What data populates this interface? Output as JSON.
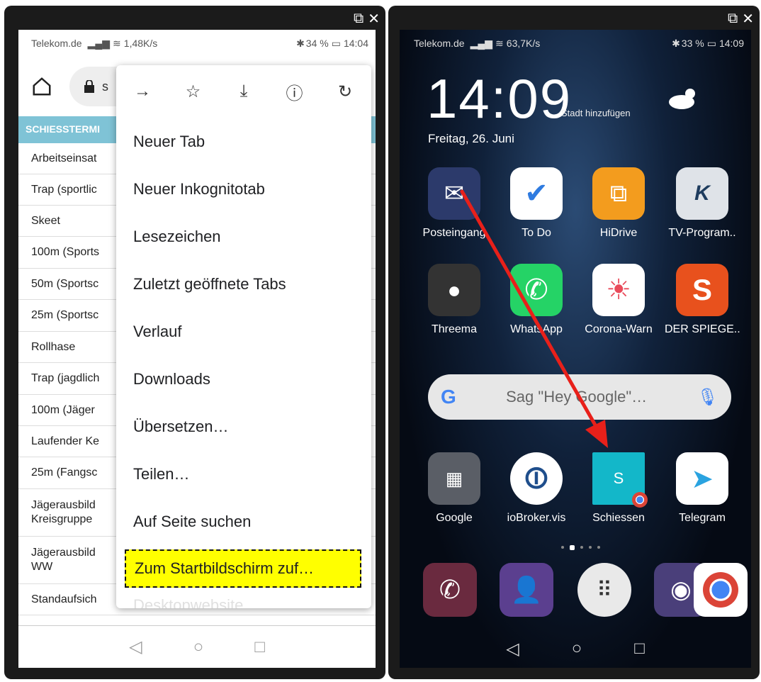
{
  "left": {
    "status": {
      "carrier": "Telekom.de",
      "speed": "1,48K/s",
      "battery": "34 %",
      "time": "14:04"
    },
    "url_prefix": "s",
    "list_header": "SCHIESSTERMI",
    "list_items": [
      "Arbeitseinsat",
      "Trap (sportlic",
      "Skeet",
      "100m (Sports",
      "50m (Sportsc",
      "25m (Sportsc",
      "Rollhase",
      "Trap (jagdlich",
      "100m (Jäger",
      "Laufender Ke",
      "25m (Fangsc",
      "Jägerausbild\nKreisgruppe",
      "Jägerausbild\nWW",
      "Standaufsich"
    ],
    "menu_icons": [
      "forward-icon",
      "star-icon",
      "download-icon",
      "info-icon",
      "refresh-icon"
    ],
    "menu": {
      "new_tab": "Neuer Tab",
      "incognito": "Neuer Inkognitotab",
      "bookmarks": "Lesezeichen",
      "recent_tabs": "Zuletzt geöffnete Tabs",
      "history": "Verlauf",
      "downloads": "Downloads",
      "translate": "Übersetzen…",
      "share": "Teilen…",
      "find": "Auf Seite suchen",
      "add_home": "Zum Startbildschirm zuf…",
      "desktop": "Desktopwebsite"
    }
  },
  "right": {
    "status": {
      "carrier": "Telekom.de",
      "speed": "63,7K/s",
      "battery": "33 %",
      "time": "14:09"
    },
    "clock": "14:09",
    "city": "Stadt hinzufügen",
    "date": "Freitag, 26. Juni",
    "apps_row1": [
      "Posteingang",
      "To Do",
      "HiDrive",
      "TV-Program.."
    ],
    "apps_row2": [
      "Threema",
      "WhatsApp",
      "Corona-Warn",
      "DER SPIEGE.."
    ],
    "search_placeholder": "Sag \"Hey Google\"…",
    "apps_row3": [
      "Google",
      "ioBroker.vis",
      "Schiessen",
      "Telegram"
    ],
    "schiessen_letter": "S",
    "colors": {
      "highlight": "#ffff00",
      "arrow": "#e8201a",
      "list_header": "#7fc3d6"
    }
  }
}
